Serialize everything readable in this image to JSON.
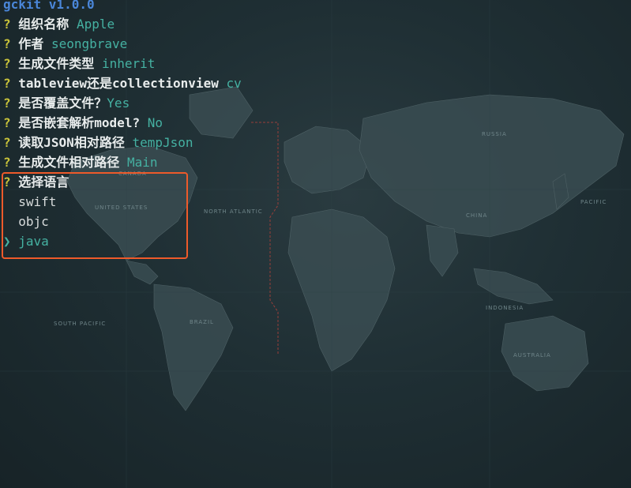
{
  "app": {
    "title": "gckit v1.0.0"
  },
  "prompts": [
    {
      "mark": "?",
      "label": "组织名称",
      "answer": "Apple"
    },
    {
      "mark": "?",
      "label": "作者",
      "answer": "seongbrave"
    },
    {
      "mark": "?",
      "label": "生成文件类型",
      "answer": "inherit"
    },
    {
      "mark": "?",
      "label": "tableview还是collectionview",
      "answer": "cv"
    },
    {
      "mark": "?",
      "label": "是否覆盖文件？",
      "answer": "Yes"
    },
    {
      "mark": "?",
      "label": "是否嵌套解析model?",
      "answer": "No"
    },
    {
      "mark": "?",
      "label": "读取JSON相对路径",
      "answer": "tempJson"
    },
    {
      "mark": "?",
      "label": "生成文件相对路径",
      "answer": "Main"
    }
  ],
  "language_prompt": {
    "mark": "?",
    "label": "选择语言",
    "options": [
      "swift",
      "objc",
      "java"
    ],
    "selected": "java",
    "pointer": "❯"
  },
  "map_labels": {
    "usa": "UNITED STATES",
    "canada": "CANADA",
    "russia": "RUSSIA",
    "china": "CHINA",
    "brazil": "BRAZIL",
    "australia": "AUSTRALIA",
    "indonesia": "INDONESIA",
    "north_atlantic": "NORTH ATLANTIC",
    "south_pacific": "SOUTH PACIFIC",
    "pacific": "PACIFIC"
  },
  "colors": {
    "background": "#1c2b30",
    "question_mark": "#c9c33a",
    "answer": "#45b1a2",
    "title": "#4a86d8",
    "highlight_border": "#ee5a2a"
  }
}
